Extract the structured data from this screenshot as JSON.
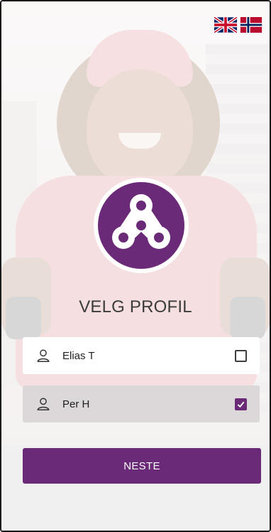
{
  "header": {
    "languages": [
      {
        "code": "en",
        "icon": "uk-flag-icon"
      },
      {
        "code": "no",
        "icon": "norway-flag-icon"
      }
    ]
  },
  "logo": {
    "icon": "app-logo-icon",
    "color": "#6b2a78"
  },
  "title": "VELG PROFIL",
  "profiles": [
    {
      "name": "Elias T",
      "icon": "user-icon",
      "selected": false
    },
    {
      "name": "Per H",
      "icon": "user-icon",
      "selected": true
    }
  ],
  "next_button": {
    "label": "NESTE"
  },
  "colors": {
    "accent": "#6b2a78",
    "selected_row": "#dcd8d9",
    "unselected_row": "#ffffff"
  }
}
